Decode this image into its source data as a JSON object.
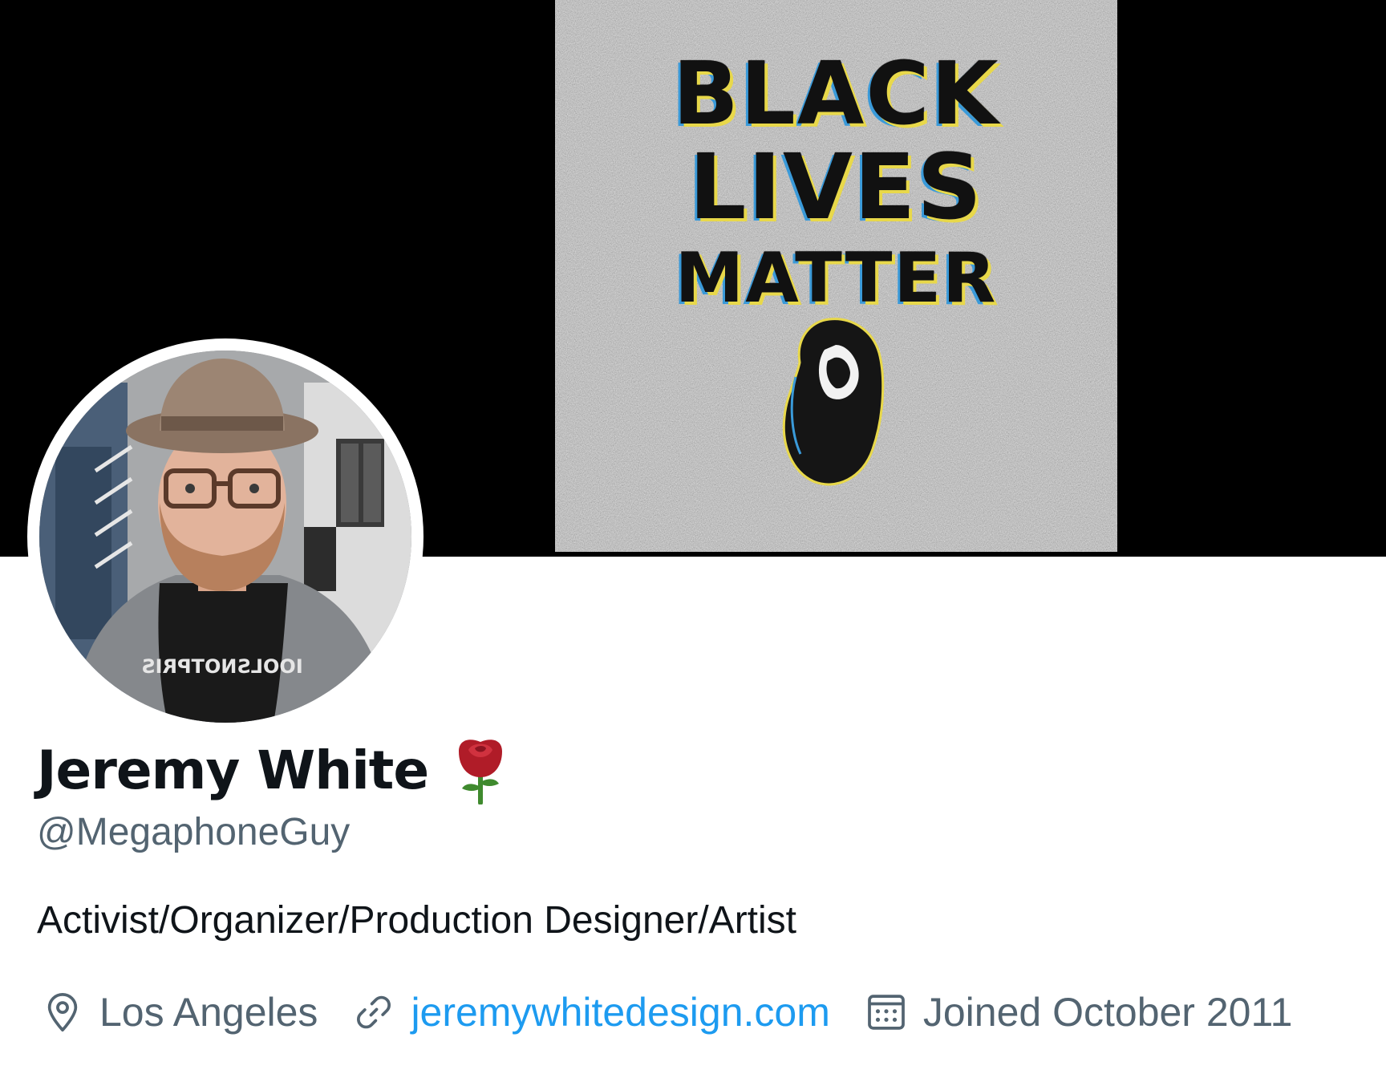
{
  "banner": {
    "poster_lines": [
      "BLACK",
      "LIVES",
      "MATTER"
    ]
  },
  "profile": {
    "display_name": "Jeremy White",
    "name_emoji_icon": "rose-icon",
    "handle": "@MegaphoneGuy",
    "bio": "Activist/Organizer/Production Designer/Artist",
    "avatar_shirt_text": "IOOLSNOTPRIS"
  },
  "meta": {
    "location": "Los Angeles",
    "location_icon": "location-pin-icon",
    "website": "jeremywhitedesign.com",
    "website_icon": "link-icon",
    "joined": "Joined October 2011",
    "joined_icon": "calendar-icon"
  },
  "colors": {
    "primary_text": "#0f1419",
    "secondary_text": "#536471",
    "link": "#1d9bf0",
    "banner_background": "#000000",
    "rose_red": "#b01c28",
    "rose_stem": "#3f8a2e"
  }
}
